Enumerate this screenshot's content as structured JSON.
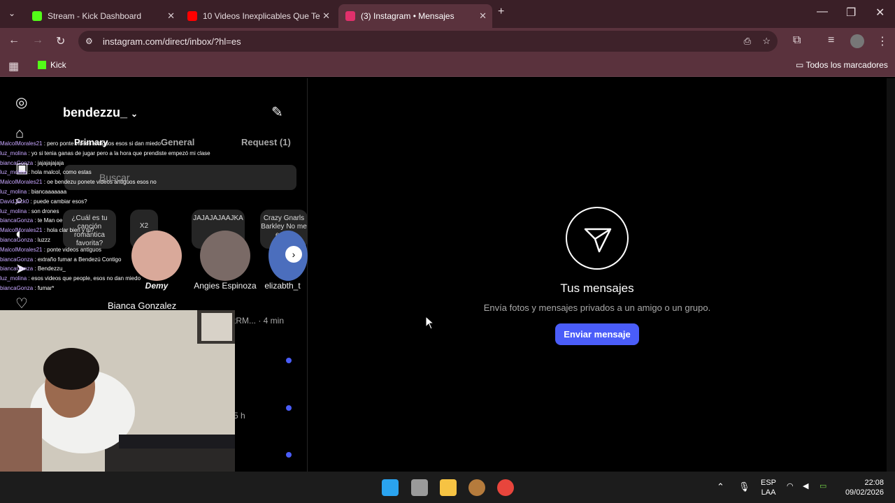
{
  "tabs": [
    {
      "label": "Stream - Kick Dashboard",
      "icon": "kick-icon",
      "color": "#53fc18"
    },
    {
      "label": "10 Videos Inexplicables Que Te",
      "icon": "youtube-icon",
      "color": "#ff0000"
    },
    {
      "label": "(3) Instagram • Mensajes",
      "icon": "instagram-icon",
      "color": "#e1306c",
      "active": true
    }
  ],
  "url": "instagram.com/direct/inbox/?hl=es",
  "bookmarks": {
    "kick": "Kick",
    "all": "Todos los marcadores"
  },
  "instagram": {
    "username": "bendezzu_",
    "tab_primary": "Primary",
    "tab_general": "General",
    "tab_requests": "Request (1)",
    "search_placeholder": "Buscar",
    "notes": [
      "¿Cuál es tu canción romántica favorita?",
      "X2",
      "JAJAJAJAAJKA",
      "Crazy Gnarls Barkley No me estoy"
    ],
    "stories": [
      "Demy",
      "Angies Espinoza",
      "elizabth_t"
    ],
    "row_name": "Bianca Gonzalez",
    "row_meta": "tRM... · 4 min",
    "row_meta2": "5 h",
    "empty_title": "Tus mensajes",
    "empty_sub": "Envía fotos y mensajes privados a un amigo o un grupo.",
    "send_button": "Enviar mensaje"
  },
  "chat": [
    {
      "u": "MalcolMorales21",
      "m": "pero ponte videos antiguos esos si dan miedo"
    },
    {
      "u": "luz_molina",
      "m": "yo si tenia ganas de jugar pero a la hora que prendiste empezó mi clase"
    },
    {
      "u": "biancaGonza",
      "m": "jajajajajaja"
    },
    {
      "u": "luz_molina",
      "m": "hola malcol, como estas"
    },
    {
      "u": "MalcolMorales21",
      "m": "oe bendezu ponete videos antiguos esos no"
    },
    {
      "u": "luz_molina",
      "m": "biancaaaaaaa"
    },
    {
      "u": "DavidJack0",
      "m": "puede cambiar esos?"
    },
    {
      "u": "luz_molina",
      "m": "son drones"
    },
    {
      "u": "biancaGonza",
      "m": "te Man oe"
    },
    {
      "u": "MalcolMorales21",
      "m": "hola clar bien y tu?"
    },
    {
      "u": "biancaGonza",
      "m": "luzzz"
    },
    {
      "u": "MalcolMorales21",
      "m": "ponte videos antiguos"
    },
    {
      "u": "biancaGonza",
      "m": "extraño fumar a Bendezú Contigo"
    },
    {
      "u": "biancaGonza",
      "m": "Bendezzu_"
    },
    {
      "u": "luz_molina",
      "m": "esos videos que people, esos no dan miedo"
    },
    {
      "u": "biancaGonza",
      "m": "fumar*"
    }
  ],
  "taskbar": {
    "lang1": "ESP",
    "lang2": "LAA",
    "time": "22:08",
    "date": "09/02/2026"
  }
}
